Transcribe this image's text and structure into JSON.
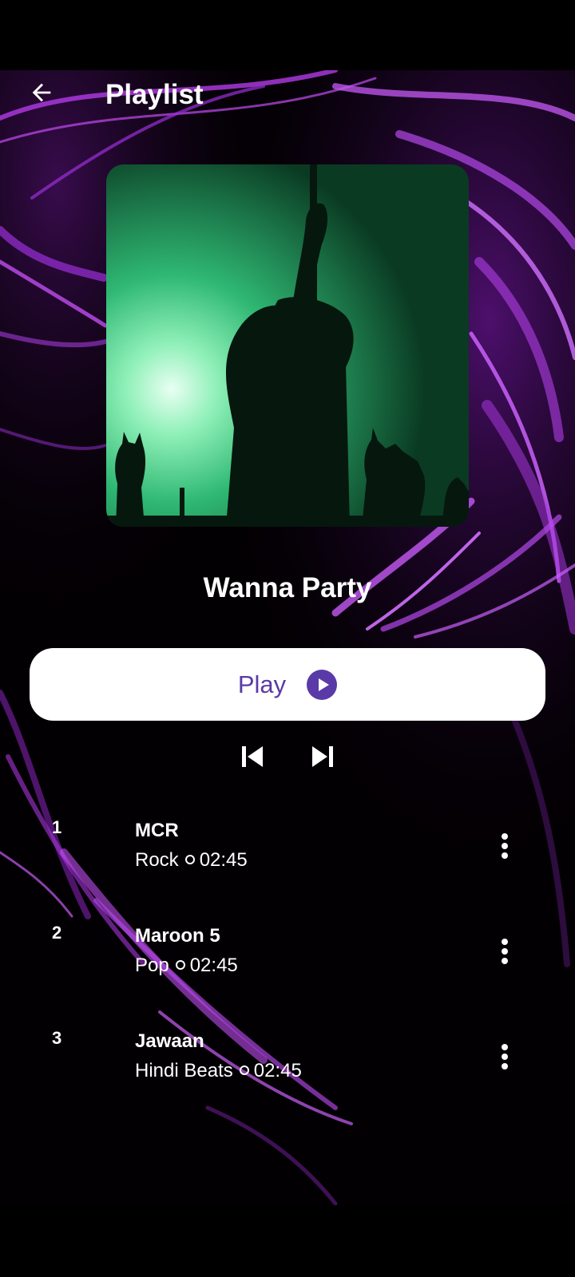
{
  "header": {
    "title": "Playlist",
    "back_icon": "arrow-left-icon"
  },
  "playlist": {
    "name": "Wanna Party",
    "cover_description_icon": "album-cover-image"
  },
  "controls": {
    "play_label": "Play",
    "play_icon": "play-circle-icon",
    "prev_icon": "skip-previous-icon",
    "next_icon": "skip-next-icon"
  },
  "tracks": [
    {
      "number": "1",
      "title": "MCR",
      "genre": "Rock",
      "duration": "02:45"
    },
    {
      "number": "2",
      "title": "Maroon 5",
      "genre": "Pop",
      "duration": "02:45"
    },
    {
      "number": "3",
      "title": "Jawaan",
      "genre": "Hindi Beats",
      "duration": "02:45"
    }
  ],
  "colors": {
    "accent": "#5a3aa8",
    "background_glow": "#a020d0",
    "cover_tint": "#1fae6a"
  }
}
